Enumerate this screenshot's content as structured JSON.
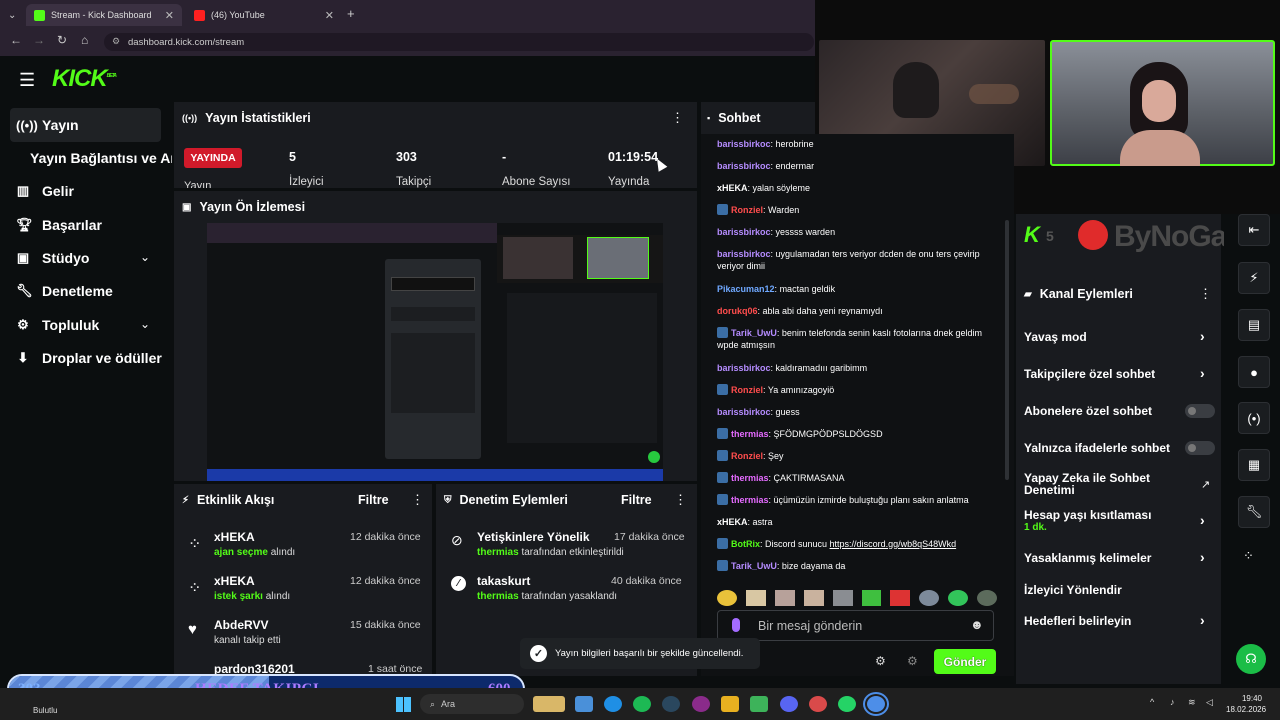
{
  "browser": {
    "tabs": [
      {
        "title": "Stream - Kick Dashboard",
        "active": true
      },
      {
        "title": "(46) YouTube",
        "active": false
      }
    ],
    "url": "dashboard.kick.com/stream"
  },
  "sidebar": {
    "logo": "KICK",
    "logo_sup": "BETA",
    "items": [
      {
        "label": "Yayın",
        "icon": "broadcast-icon"
      },
      {
        "label": "Yayın Bağlantısı ve An",
        "icon": ""
      },
      {
        "label": "Gelir",
        "icon": "chart-icon"
      },
      {
        "label": "Başarılar",
        "icon": "trophy-icon"
      },
      {
        "label": "Stüdyo",
        "icon": "studio-icon"
      },
      {
        "label": "Denetleme",
        "icon": "wrench-icon"
      },
      {
        "label": "Topluluk",
        "icon": "community-icon"
      },
      {
        "label": "Droplar ve ödüller",
        "icon": "drops-icon"
      }
    ]
  },
  "stats": {
    "title": "Yayın İstatistikleri",
    "live_badge": "YAYINDA",
    "live_label": "Yayın",
    "viewers": {
      "value": "5",
      "label": "İzleyici"
    },
    "followers": {
      "value": "303",
      "label": "Takipçi"
    },
    "subs": {
      "value": "-",
      "label": "Abone Sayısı"
    },
    "uptime": {
      "value": "01:19:54",
      "label": "Yayında"
    }
  },
  "preview": {
    "title": "Yayın Ön İzlemesi"
  },
  "activity": {
    "title": "Etkinlik Akışı",
    "filter": "Filtre",
    "items": [
      {
        "name": "xHEKA",
        "action": "ajan seçme",
        "rest": "alındı",
        "time": "12 dakika önce"
      },
      {
        "name": "xHEKA",
        "action": "istek şarkı",
        "rest": "alındı",
        "time": "12 dakika önce"
      },
      {
        "name": "AbdeRVV",
        "action": "",
        "rest": "kanalı takip etti",
        "time": "15 dakika önce"
      },
      {
        "name": "pardon316201",
        "action": "",
        "rest": "",
        "time": "1 saat önce"
      }
    ]
  },
  "moderation": {
    "title": "Denetim Eylemleri",
    "filter": "Filtre",
    "items": [
      {
        "title": "Yetişkinlere Yönelik",
        "by": "thermias",
        "rest": "tarafından etkinleştirildi",
        "time": "17 dakika önce"
      },
      {
        "title": "takaskurt",
        "by": "thermias",
        "rest": "tarafından yasaklandı",
        "time": "40 dakika önce"
      }
    ]
  },
  "chat": {
    "title": "Sohbet",
    "messages": [
      {
        "user": "barissbirkoc",
        "text": "herobrine",
        "color": "purple",
        "badge": false
      },
      {
        "user": "barissbirkoc",
        "text": "endermar",
        "color": "purple",
        "badge": false
      },
      {
        "user": "xHEKA",
        "text": "yalan söyleme",
        "color": "white",
        "badge": false
      },
      {
        "user": "Ronziel",
        "text": "Warden",
        "color": "red",
        "badge": true
      },
      {
        "user": "barissbirkoc",
        "text": "yessss warden",
        "color": "purple",
        "badge": false
      },
      {
        "user": "barissbirkoc",
        "text": "uygulamadan ters veriyor dcden de onu ters çevirip veriyor dimii",
        "color": "purple",
        "badge": false
      },
      {
        "user": "Pikacuman12",
        "text": "mactan geldik",
        "color": "blue",
        "badge": false
      },
      {
        "user": "dorukq06",
        "text": "abla abi daha yeni reynamıydı",
        "color": "red",
        "badge": false
      },
      {
        "user": "Tarik_UwU",
        "text": "benim telefonda senin kaslı fotolarına dnek geldim wpde atmışsın",
        "color": "purple",
        "badge": true
      },
      {
        "user": "barissbirkoc",
        "text": "kaldıramadııı garibimm",
        "color": "purple",
        "badge": false
      },
      {
        "user": "Ronziel",
        "text": "Ya amınızagoyiö",
        "color": "red",
        "badge": true
      },
      {
        "user": "barissbirkoc",
        "text": "guess",
        "color": "purple",
        "badge": false
      },
      {
        "user": "thermias",
        "text": "ŞFÖDMGPÖDPSLDÖGSD",
        "color": "pink",
        "badge": true
      },
      {
        "user": "Ronziel",
        "text": "Şey",
        "color": "red",
        "badge": true
      },
      {
        "user": "thermias",
        "text": "ÇAKTIRMASANA",
        "color": "pink",
        "badge": true
      },
      {
        "user": "thermias",
        "text": "üçümüzün izmirde buluştuğu planı sakın anlatma",
        "color": "pink",
        "badge": true
      },
      {
        "user": "xHEKA",
        "text": "astra",
        "color": "white",
        "badge": false
      },
      {
        "user": "BotRix",
        "text": "Discord sunucu ",
        "link": "https://discord.gg/wb8qS48Wkd",
        "color": "green",
        "badge": true
      },
      {
        "user": "Tarik_UwU",
        "text": "bize dayama da",
        "color": "purple",
        "badge": true
      }
    ],
    "input_placeholder": "Bir mesaj gönderin",
    "send_button": "Gönder"
  },
  "toast": "Yayın bilgileri başarılı bir şekilde güncellendi.",
  "channel_actions": {
    "title": "Kanal Eylemleri",
    "items": [
      {
        "label": "Yavaş mod",
        "control": "chevron"
      },
      {
        "label": "Takipçilere özel sohbet",
        "control": "chevron"
      },
      {
        "label": "Abonelere özel sohbet",
        "control": "toggle"
      },
      {
        "label": "Yalnızca ifadelerle sohbet",
        "control": "toggle"
      },
      {
        "label": "Yapay Zeka ile Sohbet Denetimi",
        "control": "external"
      },
      {
        "label": "Hesap yaşı kısıtlaması",
        "sub": "1 dk.",
        "control": "chevron"
      },
      {
        "label": "Yasaklanmış kelimeler",
        "control": "chevron"
      },
      {
        "label": "İzleyici Yönlendir",
        "control": "none"
      },
      {
        "label": "Hedefleri belirleyin",
        "control": "chevron"
      }
    ]
  },
  "overlay": {
    "brand": "ByNoGame",
    "goal_current": "303",
    "goal_label": "HEDEF TAKIPÇI",
    "goal_target": "600",
    "goal_progress": 0.505
  },
  "taskbar": {
    "weather": "Bulutlu",
    "search": "Ara",
    "time": "19:40",
    "date": "18.02.2026"
  },
  "colors": {
    "accent": "#53fc18",
    "live": "#e11d2a",
    "panel": "#191b1f"
  }
}
